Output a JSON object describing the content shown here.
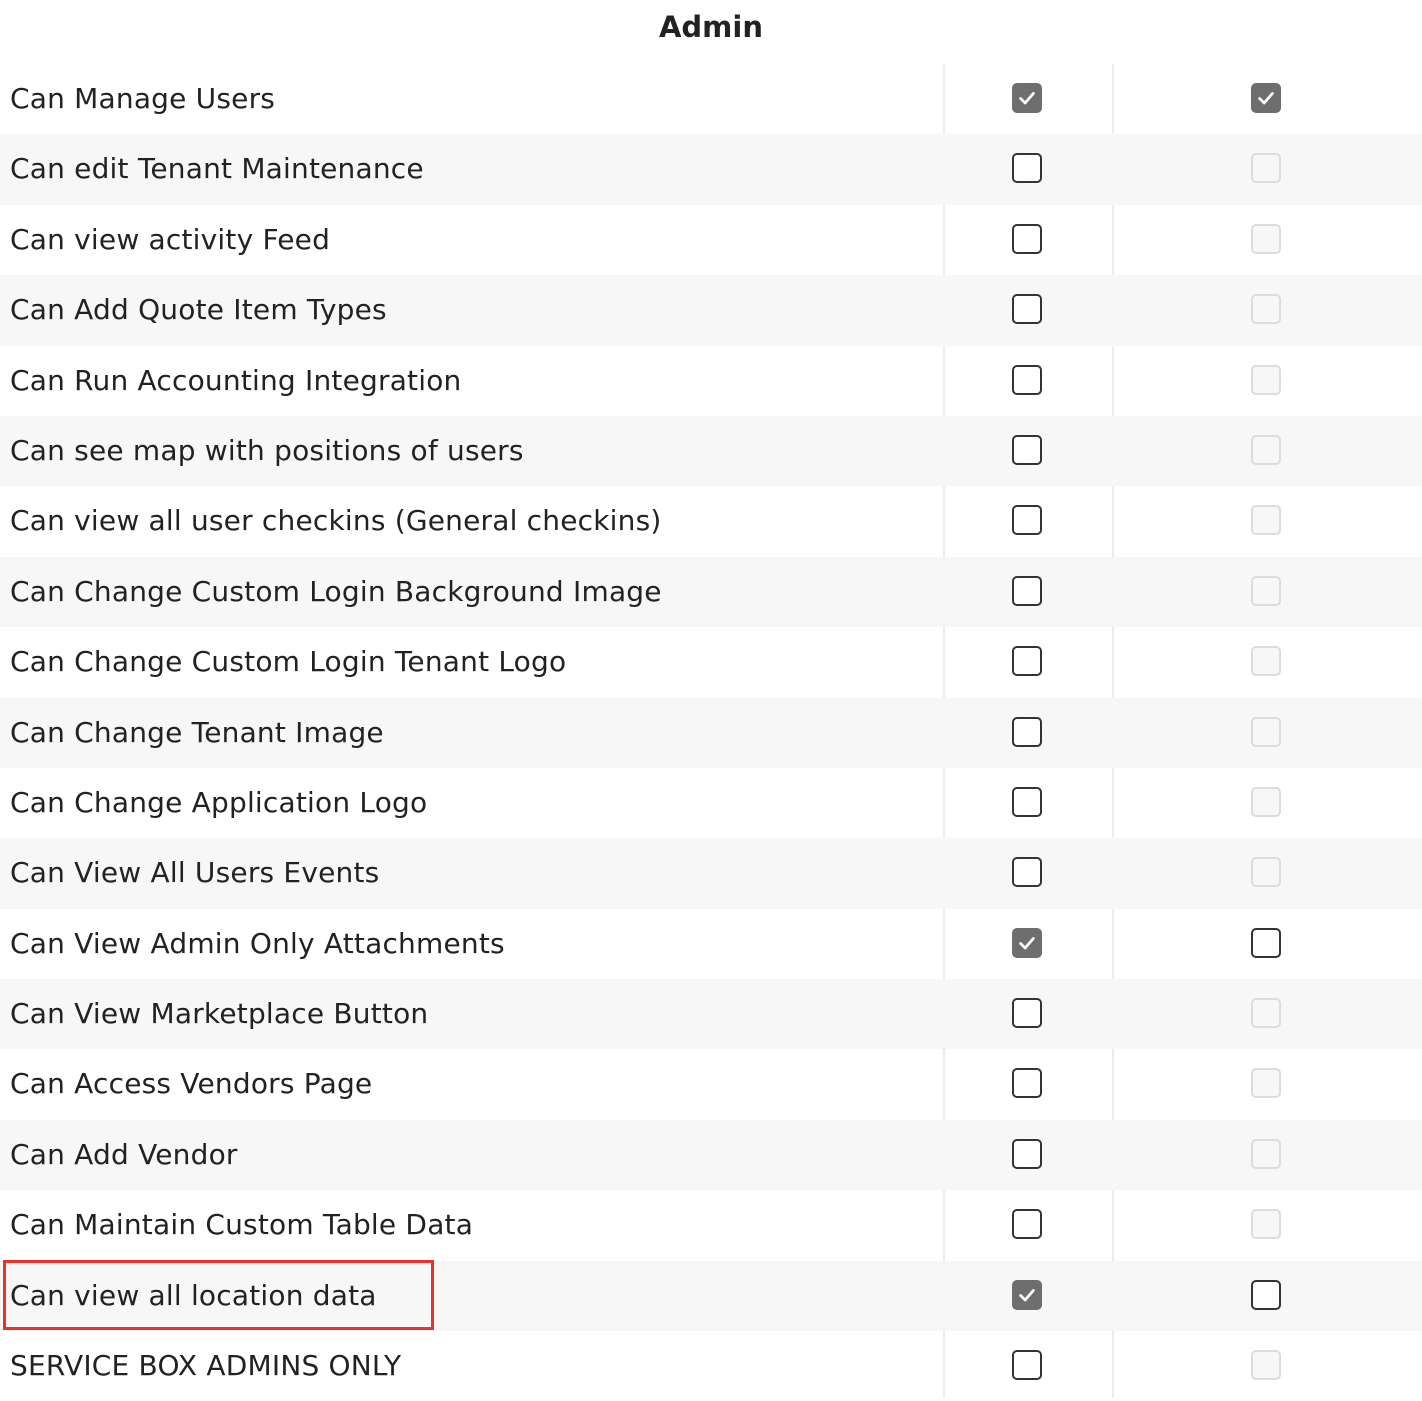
{
  "header": {
    "title": "Admin"
  },
  "colors": {
    "highlight_border": "#e8332a",
    "checked_fill": "#6e6e6e",
    "row_alt": "#f7f7f7"
  },
  "permissions": [
    {
      "label": "Can Manage Users",
      "col1": "checked",
      "col2": "checked"
    },
    {
      "label": "Can edit Tenant Maintenance",
      "col1": "unchecked",
      "col2": "disabled"
    },
    {
      "label": "Can view activity Feed",
      "col1": "unchecked",
      "col2": "disabled"
    },
    {
      "label": "Can Add Quote Item Types",
      "col1": "unchecked",
      "col2": "disabled"
    },
    {
      "label": "Can Run Accounting Integration",
      "col1": "unchecked",
      "col2": "disabled"
    },
    {
      "label": "Can see map with positions of users",
      "col1": "unchecked",
      "col2": "disabled"
    },
    {
      "label": "Can view all user checkins (General checkins)",
      "col1": "unchecked",
      "col2": "disabled"
    },
    {
      "label": "Can Change Custom Login Background Image",
      "col1": "unchecked",
      "col2": "disabled"
    },
    {
      "label": "Can Change Custom Login Tenant Logo",
      "col1": "unchecked",
      "col2": "disabled"
    },
    {
      "label": "Can Change Tenant Image",
      "col1": "unchecked",
      "col2": "disabled"
    },
    {
      "label": "Can Change Application Logo",
      "col1": "unchecked",
      "col2": "disabled"
    },
    {
      "label": "Can View All Users Events",
      "col1": "unchecked",
      "col2": "disabled"
    },
    {
      "label": "Can View Admin Only Attachments",
      "col1": "checked",
      "col2": "unchecked"
    },
    {
      "label": "Can View Marketplace Button",
      "col1": "unchecked",
      "col2": "disabled"
    },
    {
      "label": "Can Access Vendors Page",
      "col1": "unchecked",
      "col2": "disabled"
    },
    {
      "label": "Can Add Vendor",
      "col1": "unchecked",
      "col2": "disabled"
    },
    {
      "label": "Can Maintain Custom Table Data",
      "col1": "unchecked",
      "col2": "disabled"
    },
    {
      "label": "Can view all location data",
      "col1": "checked",
      "col2": "unchecked",
      "highlighted": true
    },
    {
      "label": "SERVICE BOX ADMINS ONLY",
      "col1": "unchecked",
      "col2": "disabled"
    }
  ]
}
